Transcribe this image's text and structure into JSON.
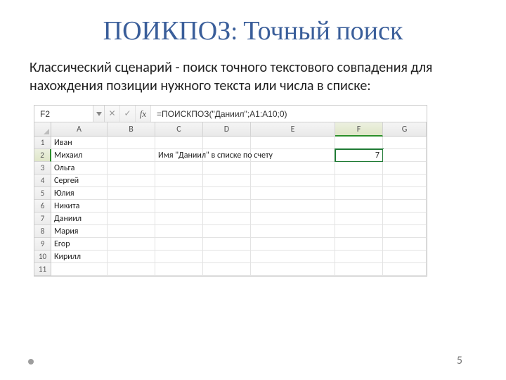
{
  "title": "ПОИКПОЗ: Точный поиск",
  "description": "Классический сценарий - поиск точного текстового совпадения для нахождения позиции нужного текста или числа в списке:",
  "page_number": "5",
  "excel": {
    "active_cell": "F2",
    "formula": "=ПОИСКПОЗ(\"Даниил\";A1:A10;0)",
    "columns": [
      "A",
      "B",
      "C",
      "D",
      "E",
      "F",
      "G"
    ],
    "rows": [
      "1",
      "2",
      "3",
      "4",
      "5",
      "6",
      "7",
      "8",
      "9",
      "10",
      "11"
    ],
    "names": [
      "Иван",
      "Михаил",
      "Ольга",
      "Сергей",
      "Юлия",
      "Никита",
      "Даниил",
      "Мария",
      "Егор",
      "Кирилл"
    ],
    "label_text": "Имя \"Даниил\" в списке по счету",
    "result_value": "7"
  }
}
